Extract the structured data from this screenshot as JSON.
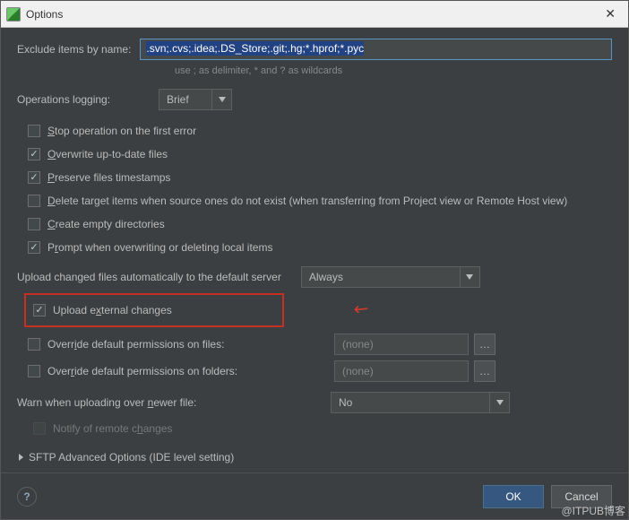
{
  "window": {
    "title": "Options"
  },
  "exclude": {
    "label": "Exclude items by name:",
    "value": ".svn;.cvs;.idea;.DS_Store;.git;.hg;*.hprof;*.pyc",
    "hint": "use ; as delimiter, * and ? as wildcards"
  },
  "logging": {
    "label": "Operations logging:",
    "value": "Brief"
  },
  "checks": {
    "stop": "Stop operation on the first error",
    "overwrite": "Overwrite up-to-date files",
    "preserve": "Preserve files timestamps",
    "delete": "Delete target items when source ones do not exist (when transferring from Project view or Remote Host view)",
    "create": "Create empty directories",
    "prompt": "Prompt when overwriting or deleting local items"
  },
  "upload": {
    "label": "Upload changed files automatically to the default server",
    "value": "Always",
    "external": "Upload external changes",
    "perm_files": "Override default permissions on files:",
    "perm_folders": "Override default permissions on folders:",
    "perm_placeholder": "(none)"
  },
  "warn": {
    "label": "Warn when uploading over newer file:",
    "value": "No",
    "notify": "Notify of remote changes"
  },
  "expander": {
    "label": "SFTP Advanced Options (IDE level setting)"
  },
  "footer": {
    "ok": "OK",
    "cancel": "Cancel"
  },
  "watermark": "@ITPUB博客"
}
